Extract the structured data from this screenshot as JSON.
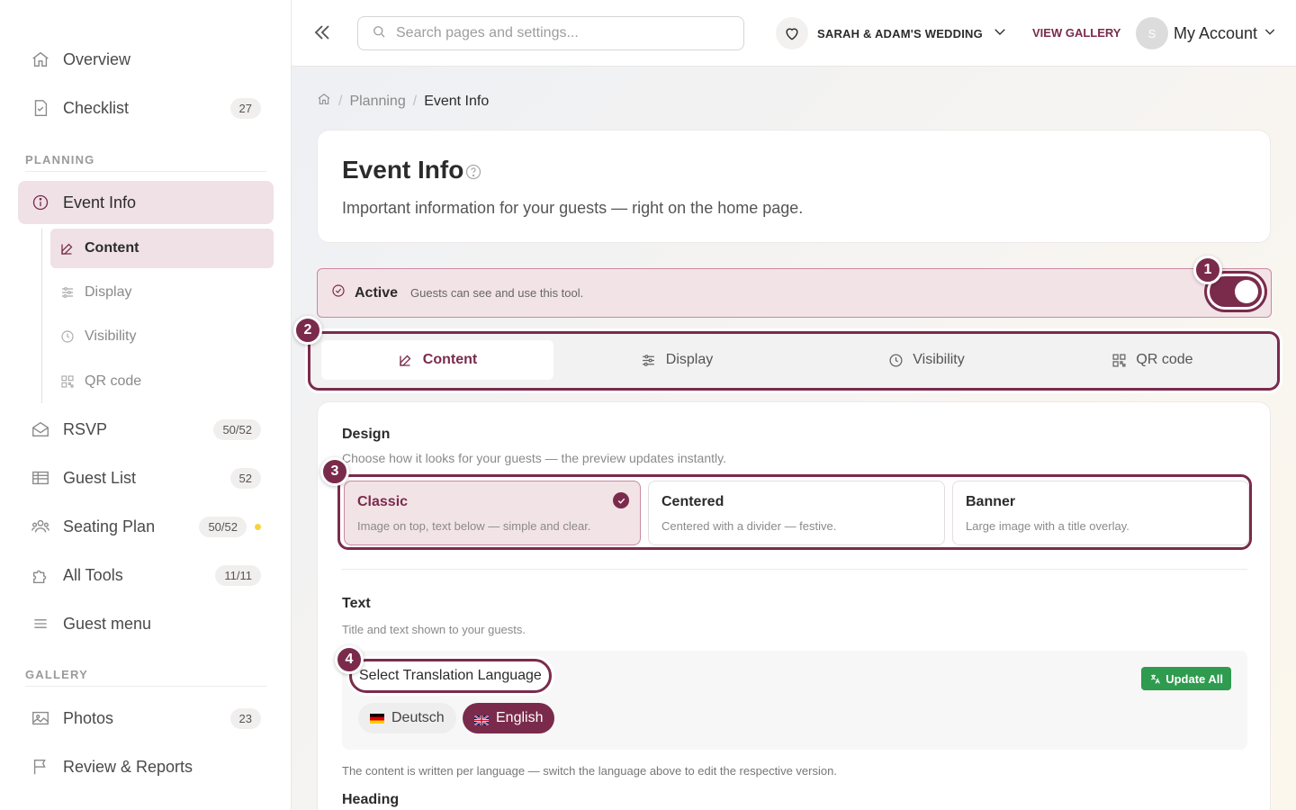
{
  "sidebar": {
    "items_top": [
      {
        "label": "Overview",
        "icon": "home-icon"
      },
      {
        "label": "Checklist",
        "icon": "checklist-icon",
        "badge": "27"
      }
    ],
    "planning_label": "PLANNING",
    "event_info": {
      "label": "Event Info",
      "icon": "info-icon"
    },
    "sub_items": [
      {
        "label": "Content",
        "icon": "edit-icon"
      },
      {
        "label": "Display",
        "icon": "sliders-icon"
      },
      {
        "label": "Visibility",
        "icon": "clock-icon"
      },
      {
        "label": "QR code",
        "icon": "qr-icon"
      }
    ],
    "items_planning": [
      {
        "label": "RSVP",
        "icon": "mail-icon",
        "badge": "50/52"
      },
      {
        "label": "Guest List",
        "icon": "table-icon",
        "badge": "52"
      },
      {
        "label": "Seating Plan",
        "icon": "people-icon",
        "badge": "50/52"
      },
      {
        "label": "All Tools",
        "icon": "puzzle-icon",
        "badge": "11/11"
      },
      {
        "label": "Guest menu",
        "icon": "menu-icon"
      }
    ],
    "gallery_label": "GALLERY",
    "items_gallery": [
      {
        "label": "Photos",
        "icon": "image-icon",
        "badge": "23"
      },
      {
        "label": "Review & Reports",
        "icon": "flag-icon"
      }
    ]
  },
  "topbar": {
    "search_placeholder": "Search pages and settings...",
    "wedding_name": "SARAH & ADAM'S WEDDING",
    "view_gallery": "VIEW GALLERY",
    "avatar_initial": "S",
    "account_label": "My Account"
  },
  "breadcrumb": {
    "parent": "Planning",
    "current": "Event Info"
  },
  "header": {
    "title": "Event Info",
    "subtitle": "Important information for your guests — right on the home page."
  },
  "active_bar": {
    "label": "Active",
    "desc": "Guests can see and use this tool.",
    "enabled": true
  },
  "tabs": [
    {
      "label": "Content",
      "icon": "edit-icon"
    },
    {
      "label": "Display",
      "icon": "sliders-icon"
    },
    {
      "label": "Visibility",
      "icon": "clock-icon"
    },
    {
      "label": "QR code",
      "icon": "qr-icon"
    }
  ],
  "design": {
    "heading": "Design",
    "desc": "Choose how it looks for your guests — the preview updates instantly.",
    "options": [
      {
        "title": "Classic",
        "desc": "Image on top, text below — simple and clear.",
        "selected": true
      },
      {
        "title": "Centered",
        "desc": "Centered with a divider — festive."
      },
      {
        "title": "Banner",
        "desc": "Large image with a title overlay."
      }
    ]
  },
  "text_section": {
    "heading": "Text",
    "desc": "Title and text shown to your guests.",
    "lang_label": "Select Translation Language",
    "update_all": "Update All",
    "languages": [
      "Deutsch",
      "English"
    ],
    "note": "The content is written per language — switch the language above to edit the respective version.",
    "field_heading": "Heading"
  },
  "markers": [
    "1",
    "2",
    "3",
    "4"
  ],
  "colors": {
    "accent": "#7a2b4b",
    "accent_light": "#efe1e5",
    "success": "#2e9b4f",
    "warning_dot": "#f5d33a"
  }
}
